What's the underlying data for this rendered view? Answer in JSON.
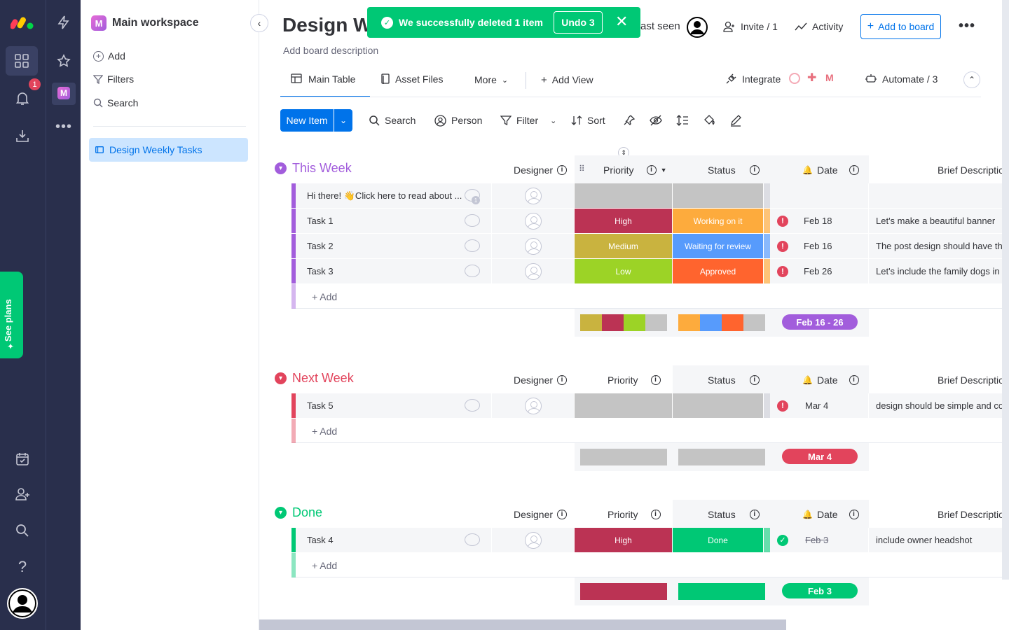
{
  "colors": {
    "rail": "#292f4c",
    "accent": "#0073ea",
    "toast": "#00c875",
    "this_week": "#a25ddc",
    "next_week": "#e2445c",
    "done": "#00c875"
  },
  "leftnav": {
    "workspace": "Main workspace",
    "workspace_initial": "M",
    "add": "Add",
    "filters": "Filters",
    "search": "Search",
    "board": "Design Weekly Tasks"
  },
  "rail": {
    "notif_count": "1",
    "see_plans": "See plans"
  },
  "header": {
    "title": "Design We",
    "last_seen": "ast seen",
    "invite": "Invite / 1",
    "activity": "Activity",
    "add_to_board": "Add to board",
    "description": "Add board description"
  },
  "toast": {
    "message": "We successfully deleted 1 item",
    "undo": "Undo 3"
  },
  "views": {
    "main_table": "Main Table",
    "asset_files": "Asset Files",
    "more": "More",
    "add_view": "Add View",
    "integrate": "Integrate",
    "automate": "Automate / 3"
  },
  "toolbar": {
    "new_item": "New Item",
    "search": "Search",
    "person": "Person",
    "filter": "Filter",
    "sort": "Sort"
  },
  "columns": {
    "designer": "Designer",
    "priority": "Priority",
    "status": "Status",
    "date": "Date",
    "brief": "Brief Descriptio"
  },
  "groups": [
    {
      "title": "This Week",
      "add": "+ Add",
      "date_range": "Feb 16 - 26",
      "rows": [
        {
          "name": "Hi there! 👋Click here to read about ...",
          "priority": "",
          "status": "",
          "date": "",
          "brief": "",
          "comments": "1"
        },
        {
          "name": "Task 1",
          "priority": "High",
          "status": "Working on it",
          "date": "Feb 18",
          "brief": "Let's make a beautiful banner"
        },
        {
          "name": "Task 2",
          "priority": "Medium",
          "status": "Waiting for review",
          "date": "Feb 16",
          "brief": "The post design should have th"
        },
        {
          "name": "Task 3",
          "priority": "Low",
          "status": "Approved",
          "date": "Feb 26",
          "brief": "Let's include the family dogs in"
        }
      ]
    },
    {
      "title": "Next Week",
      "add": "+ Add",
      "date_range": "Mar 4",
      "rows": [
        {
          "name": "Task 5",
          "priority": "",
          "status": "",
          "date": "Mar 4",
          "brief": "design should be simple and co"
        }
      ]
    },
    {
      "title": "Done",
      "add": "+ Add",
      "date_range": "Feb 3",
      "rows": [
        {
          "name": "Task 4",
          "priority": "High",
          "status": "Done",
          "date": "Feb 3",
          "brief": "include owner headshot"
        }
      ]
    }
  ]
}
